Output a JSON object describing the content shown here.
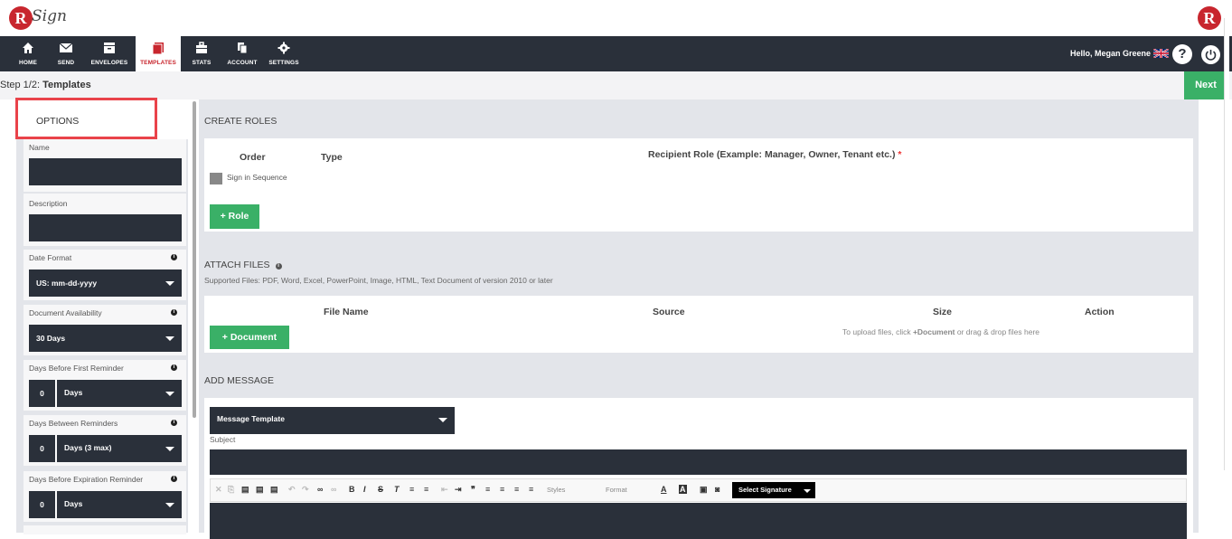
{
  "brand": {
    "logo_letter": "R",
    "logo_script": "Sign",
    "accent": "#c8262e"
  },
  "nav": {
    "items": [
      {
        "label": "HOME",
        "icon": "home-icon"
      },
      {
        "label": "SEND",
        "icon": "envelope-icon"
      },
      {
        "label": "ENVELOPES",
        "icon": "inbox-icon"
      },
      {
        "label": "TEMPLATES",
        "icon": "template-icon",
        "active": true
      },
      {
        "label": "STATS",
        "icon": "briefcase-icon"
      },
      {
        "label": "ACCOUNT",
        "icon": "documents-icon"
      },
      {
        "label": "SETTINGS",
        "icon": "gear-icon"
      }
    ],
    "greeting": "Hello, Megan Greene",
    "help_glyph": "?",
    "flag_icon": "uk-flag-icon",
    "power_icon": "power-icon"
  },
  "step": {
    "prefix": "Step 1/2: ",
    "title": "Templates",
    "next_label": "Next"
  },
  "options": {
    "title": "OPTIONS",
    "name_label": "Name",
    "description_label": "Description",
    "date_format_label": "Date Format",
    "date_format_value": "US: mm-dd-yyyy",
    "availability_label": "Document Availability",
    "availability_value": "30 Days",
    "first_reminder_label": "Days Before First Reminder",
    "first_reminder_num": "0",
    "first_reminder_unit": "Days",
    "between_label": "Days Between Reminders",
    "between_num": "0",
    "between_unit": "Days (3 max)",
    "expiration_label": "Days Before Expiration Reminder",
    "expiration_num": "0",
    "expiration_unit": "Days",
    "info_glyph": "i"
  },
  "roles": {
    "title": "CREATE ROLES",
    "order_header": "Order",
    "type_header": "Type",
    "recipient_header": "Recipient Role (Example: Manager, Owner, Tenant etc.)",
    "required_mark": "*",
    "sequence_label": "Sign in Sequence",
    "add_role_label": "+ Role"
  },
  "files": {
    "title": "ATTACH FILES",
    "supported": "Supported Files: PDF, Word, Excel, PowerPoint, Image, HTML, Text Document of version 2010 or later",
    "file_name_header": "File Name",
    "source_header": "Source",
    "size_header": "Size",
    "action_header": "Action",
    "add_document_label": "+ Document",
    "upload_hint_pre": "To upload files, click ",
    "upload_hint_bold": "+Document",
    "upload_hint_post": " or drag & drop files here"
  },
  "message": {
    "title": "ADD MESSAGE",
    "template_value": "Message Template",
    "subject_label": "Subject",
    "styles_label": "Styles",
    "format_label": "Format",
    "signature_label": "Select Signature"
  }
}
